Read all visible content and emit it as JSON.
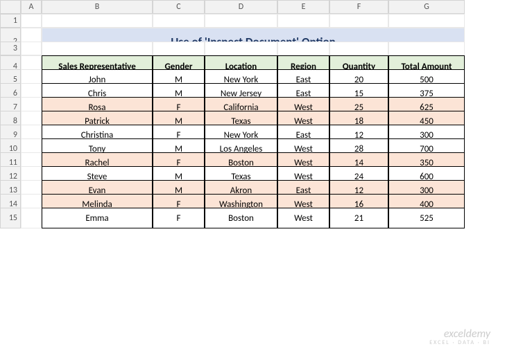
{
  "columns": [
    "A",
    "B",
    "C",
    "D",
    "E",
    "F",
    "G"
  ],
  "rows": [
    "1",
    "2",
    "3",
    "4",
    "5",
    "6",
    "7",
    "8",
    "9",
    "10",
    "11",
    "12",
    "13",
    "14",
    "15"
  ],
  "title": "Use of 'Inspect Document' Option",
  "headers": [
    "Sales Representative",
    "Gender",
    "Location",
    "Region",
    "Quantity",
    "Total Amount"
  ],
  "data": [
    {
      "rep": "John",
      "gender": "M",
      "loc": "New York",
      "region": "East",
      "qty": "20",
      "amt": "500",
      "hl": false
    },
    {
      "rep": "Chris",
      "gender": "M",
      "loc": "New Jersey",
      "region": "East",
      "qty": "15",
      "amt": "375",
      "hl": false
    },
    {
      "rep": "Rosa",
      "gender": "F",
      "loc": "California",
      "region": "West",
      "qty": "25",
      "amt": "625",
      "hl": true
    },
    {
      "rep": "Patrick",
      "gender": "M",
      "loc": "Texas",
      "region": "West",
      "qty": "18",
      "amt": "450",
      "hl": true
    },
    {
      "rep": "Christina",
      "gender": "F",
      "loc": "New York",
      "region": "East",
      "qty": "12",
      "amt": "300",
      "hl": false
    },
    {
      "rep": "Tony",
      "gender": "M",
      "loc": "Los Angeles",
      "region": "West",
      "qty": "28",
      "amt": "700",
      "hl": false
    },
    {
      "rep": "Rachel",
      "gender": "F",
      "loc": "Boston",
      "region": "West",
      "qty": "14",
      "amt": "350",
      "hl": true
    },
    {
      "rep": "Steve",
      "gender": "M",
      "loc": "Texas",
      "region": "West",
      "qty": "24",
      "amt": "600",
      "hl": false
    },
    {
      "rep": "Evan",
      "gender": "M",
      "loc": "Akron",
      "region": "East",
      "qty": "12",
      "amt": "300",
      "hl": true
    },
    {
      "rep": "Melinda",
      "gender": "F",
      "loc": "Washington",
      "region": "West",
      "qty": "16",
      "amt": "400",
      "hl": true
    },
    {
      "rep": "Emma",
      "gender": "F",
      "loc": "Boston",
      "region": "West",
      "qty": "21",
      "amt": "525",
      "hl": false
    }
  ],
  "watermark": {
    "main": "exceldemy",
    "sub": "EXCEL · DATA · BI"
  },
  "chart_data": {
    "type": "table",
    "title": "Use of 'Inspect Document' Option",
    "columns": [
      "Sales Representative",
      "Gender",
      "Location",
      "Region",
      "Quantity",
      "Total Amount"
    ],
    "rows": [
      [
        "John",
        "M",
        "New York",
        "East",
        20,
        500
      ],
      [
        "Chris",
        "M",
        "New Jersey",
        "East",
        15,
        375
      ],
      [
        "Rosa",
        "F",
        "California",
        "West",
        25,
        625
      ],
      [
        "Patrick",
        "M",
        "Texas",
        "West",
        18,
        450
      ],
      [
        "Christina",
        "F",
        "New York",
        "East",
        12,
        300
      ],
      [
        "Tony",
        "M",
        "Los Angeles",
        "West",
        28,
        700
      ],
      [
        "Rachel",
        "F",
        "Boston",
        "West",
        14,
        350
      ],
      [
        "Steve",
        "M",
        "Texas",
        "West",
        24,
        600
      ],
      [
        "Evan",
        "M",
        "Akron",
        "East",
        12,
        300
      ],
      [
        "Melinda",
        "F",
        "Washington",
        "West",
        16,
        400
      ],
      [
        "Emma",
        "F",
        "Boston",
        "West",
        21,
        525
      ]
    ]
  }
}
